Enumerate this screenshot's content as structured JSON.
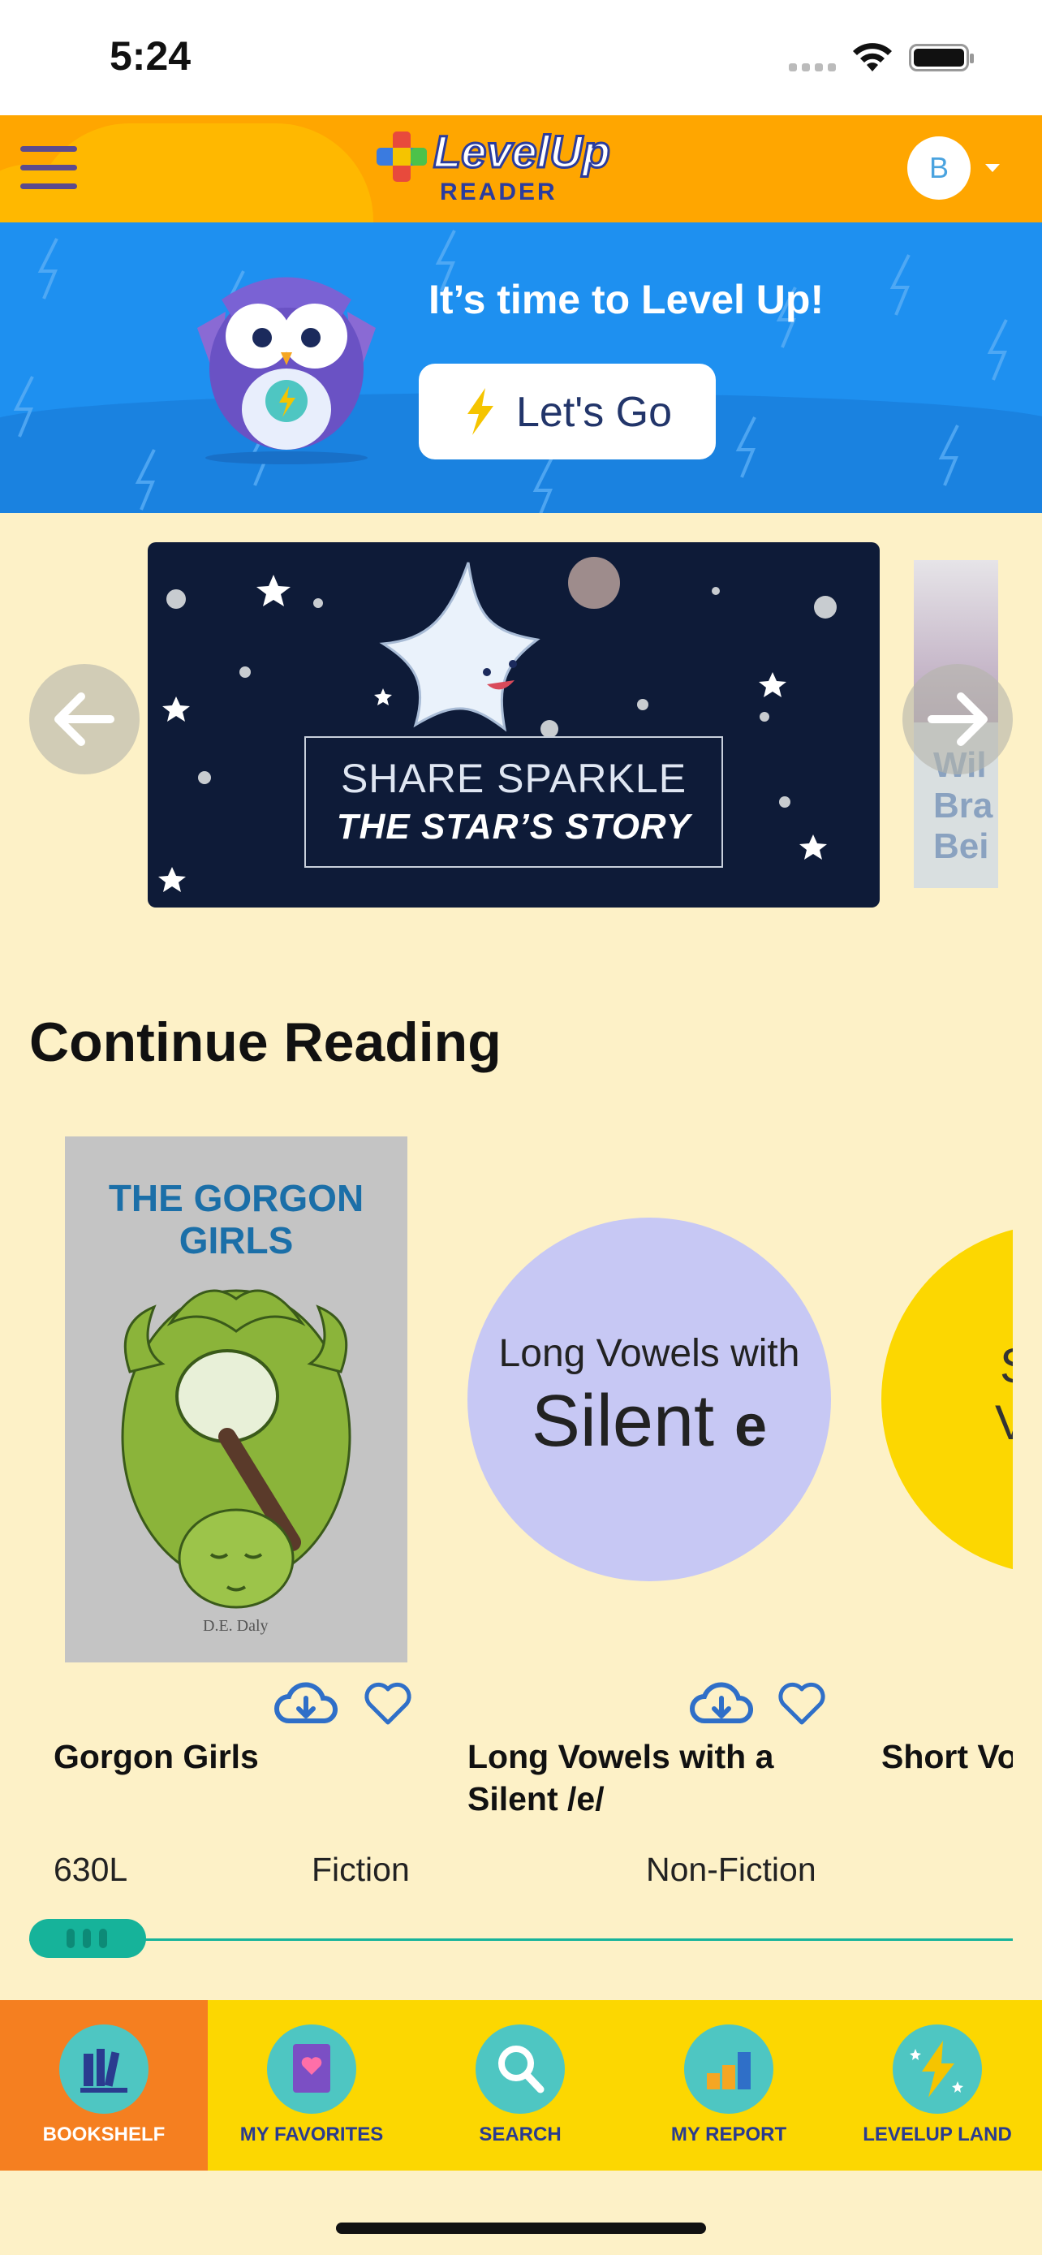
{
  "status_bar": {
    "time": "5:24"
  },
  "header": {
    "logo_top": "LevelUp",
    "logo_bottom": "READER",
    "avatar_initial": "B"
  },
  "promo": {
    "headline": "It’s time to Level Up!",
    "button_label": "Let's Go"
  },
  "carousel": {
    "slide_title_line1": "SHARE SPARKLE",
    "slide_title_line2": "THE STAR’S STORY",
    "peek_text": [
      "Wil",
      "Bra",
      "Bei"
    ]
  },
  "continue_reading": {
    "title": "Continue Reading",
    "books": [
      {
        "title": "Gorgon Girls",
        "cover_title": "THE GORGON GIRLS",
        "cover_author": "D.E. Daly",
        "level": "630L",
        "genre": "Fiction"
      },
      {
        "title": "Long Vowels with a Silent /e/",
        "cover_line1": "Long Vowels with",
        "cover_line2": "Silent",
        "cover_letter": "e",
        "genre": "Non-Fiction"
      },
      {
        "title": "Short Vo",
        "cover_peek1": "S",
        "cover_peek2": "V"
      }
    ]
  },
  "scroll_progress": 0.117,
  "nav": {
    "items": [
      {
        "label": "BOOKSHELF",
        "icon": "bookshelf-icon",
        "active": true
      },
      {
        "label": "MY FAVORITES",
        "icon": "favorites-book-icon",
        "active": false
      },
      {
        "label": "SEARCH",
        "icon": "search-icon",
        "active": false
      },
      {
        "label": "MY REPORT",
        "icon": "bar-chart-icon",
        "active": false
      },
      {
        "label": "LEVELUP LAND",
        "icon": "lightning-icon",
        "active": false
      }
    ]
  },
  "colors": {
    "header": "#ffa600",
    "promo": "#1e90f0",
    "background": "#fdf1c7",
    "nav": "#fcd701",
    "nav_active": "#f57f20",
    "teal": "#16b39a"
  }
}
